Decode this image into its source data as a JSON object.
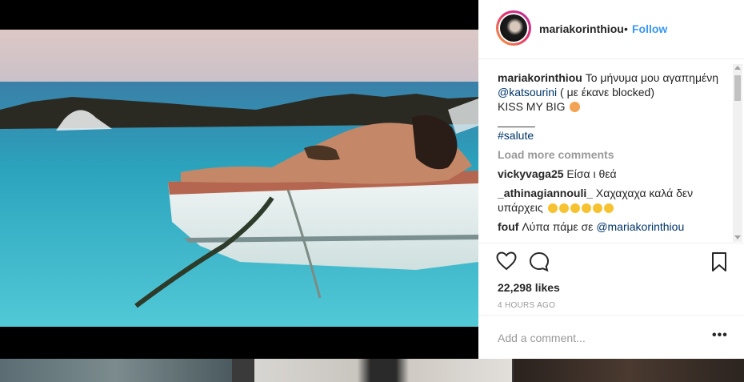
{
  "post": {
    "username": "mariakorinthiou",
    "dot": "•",
    "follow_label": "Follow"
  },
  "caption": {
    "username": "mariakorinthiou",
    "text_1": "Το μήνυμα μου αγαπημένη",
    "mention": "@katsourini",
    "text_2": "( με έκανε blocked)",
    "line_2": "KISS MY BIG",
    "separator": "______",
    "hashtag": "#salute"
  },
  "load_more_label": "Load more comments",
  "comments": [
    {
      "username": "vickyvaga25",
      "text": "Είσα ι θεά"
    },
    {
      "username": "_athinagiannouli_",
      "text": "Χαχαχαχα καλά δεν υπάρχεις"
    },
    {
      "username": "fouf",
      "text": "Λύπα πάμε σε",
      "mention": "@mariakorinthiou"
    }
  ],
  "actions": {
    "like_icon": "heart-icon",
    "comment_icon": "comment-bubble-icon",
    "save_icon": "bookmark-icon"
  },
  "likes_label": "22,298 likes",
  "time_label": "4 HOURS AGO",
  "add_comment_placeholder": "Add a comment...",
  "more_label": "•••",
  "colors": {
    "follow_blue": "#3897f0",
    "link_dark": "#003569",
    "muted": "#999999",
    "sea": "#2fb3c6",
    "boat": "#e6eeee"
  }
}
